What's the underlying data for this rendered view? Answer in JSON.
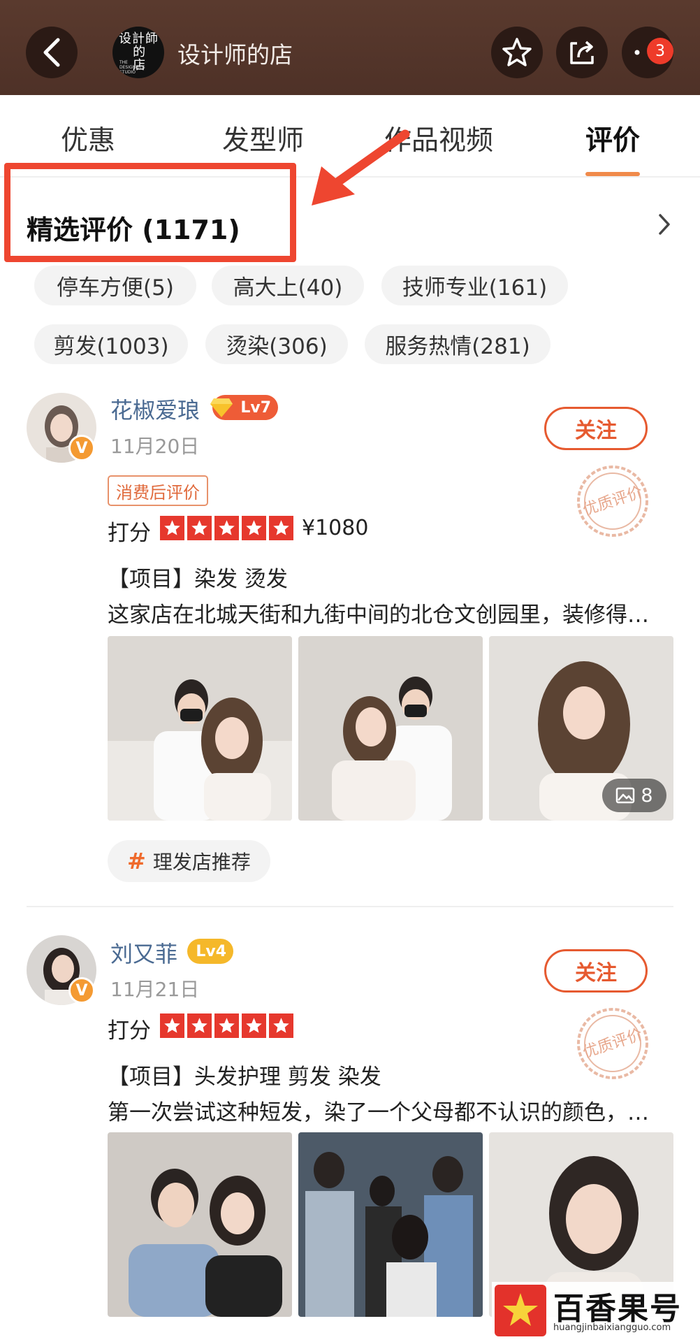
{
  "header": {
    "shop_name": "设计师的店",
    "logo_text": "设计师的店",
    "notification_count": "3",
    "icons": [
      "back-arrow-icon",
      "star-outline-icon",
      "share-icon",
      "more-dots-icon"
    ]
  },
  "tabs": [
    {
      "label": "优惠",
      "active": false
    },
    {
      "label": "发型师",
      "active": false
    },
    {
      "label": "作品视频",
      "active": false
    },
    {
      "label": "评价",
      "active": true
    }
  ],
  "colors": {
    "header_bg": "#5a3a2e",
    "accent": "#e65a30",
    "star_red": "#e6382d",
    "annotation_red": "#ee4630",
    "username_blue": "#4a6a92"
  },
  "section": {
    "title": "精选评价 (1171)"
  },
  "tags": [
    "停车方便(5)",
    "高大上(40)",
    "技师专业(161)",
    "剪发(1003)",
    "烫染(306)",
    "服务热情(281)"
  ],
  "reviews": [
    {
      "username": "花椒爱琅",
      "level": "Lv7",
      "date": "11月20日",
      "follow_label": "关注",
      "consume_tag": "消费后评价",
      "score_label": "打分",
      "stars": 5,
      "price": "¥1080",
      "project": "【项目】染发 烫发",
      "text": "这家店在北城天街和九街中间的北仓文创园里，装修得…",
      "photo_count": "8",
      "hashtag": "理发店推荐",
      "stamp": "优质评价"
    },
    {
      "username": "刘又菲",
      "level": "Lv4",
      "date": "11月21日",
      "follow_label": "关注",
      "score_label": "打分",
      "stars": 5,
      "project": "【项目】头发护理 剪发 染发",
      "text": "第一次尝试这种短发，染了一个父母都不认识的颜色，…",
      "stamp": "优质评价"
    }
  ],
  "watermark": {
    "name": "百香果号",
    "url": "huangjinbaixiangguo.com"
  }
}
